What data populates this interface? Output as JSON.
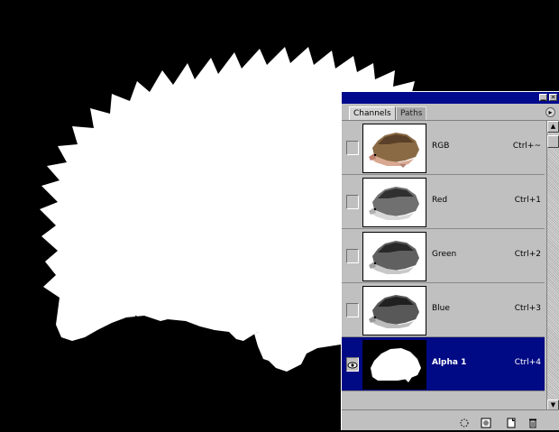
{
  "colors": {
    "canvas_background": "#000000",
    "mask_foreground": "#ffffff",
    "panel_background": "#c0c0c0",
    "titlebar": "#000a8c",
    "selection": "#000a85"
  },
  "panel": {
    "titlebar_buttons": [
      "minimize-icon",
      "close-icon"
    ],
    "tabs": [
      {
        "label": "Channels",
        "active": true
      },
      {
        "label": "Paths",
        "active": false
      }
    ],
    "menu_icon": "panel-menu-arrow-icon",
    "channels": [
      {
        "name": "RGB",
        "shortcut": "Ctrl+~",
        "visible": false,
        "selected": false,
        "thumb": "color-hedgehog"
      },
      {
        "name": "Red",
        "shortcut": "Ctrl+1",
        "visible": false,
        "selected": false,
        "thumb": "gray-hedgehog"
      },
      {
        "name": "Green",
        "shortcut": "Ctrl+2",
        "visible": false,
        "selected": false,
        "thumb": "gray-hedgehog"
      },
      {
        "name": "Blue",
        "shortcut": "Ctrl+3",
        "visible": false,
        "selected": false,
        "thumb": "gray-hedgehog"
      },
      {
        "name": "Alpha 1",
        "shortcut": "Ctrl+4",
        "visible": true,
        "selected": true,
        "thumb": "mask-hedgehog"
      }
    ],
    "footer_icons": [
      "load-selection-icon",
      "save-selection-icon",
      "new-channel-icon",
      "delete-channel-icon"
    ]
  }
}
